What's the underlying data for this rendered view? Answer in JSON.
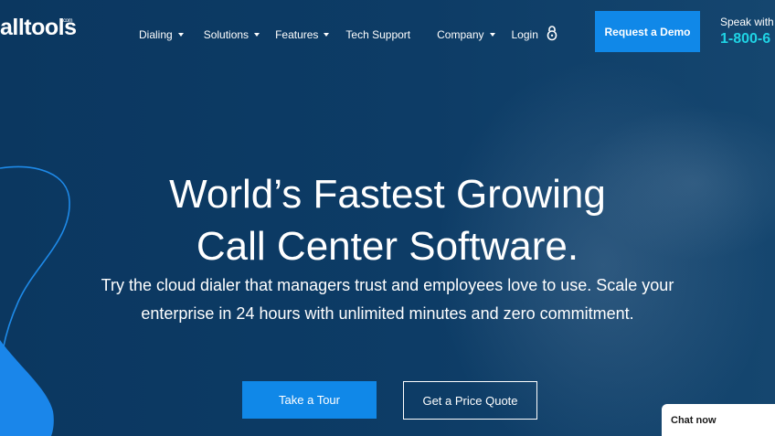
{
  "brand": {
    "logo_text": "alltools",
    "logo_sup": ".com"
  },
  "nav": {
    "items": [
      {
        "label": "Dialing",
        "dropdown": true
      },
      {
        "label": "Solutions",
        "dropdown": true
      },
      {
        "label": "Features",
        "dropdown": true
      },
      {
        "label": "Tech Support",
        "dropdown": false
      },
      {
        "label": "Company",
        "dropdown": true
      },
      {
        "label": "Login",
        "icon": "lock-icon"
      }
    ]
  },
  "header": {
    "demo_label": "Request a Demo",
    "speak_label": "Speak with a",
    "phone": "1-800-6"
  },
  "hero": {
    "headline_line1": "World’s Fastest Growing",
    "headline_line2": "Call Center Software.",
    "sub_line1": "Try the cloud dialer that managers trust and employees love to use. Scale your",
    "sub_line2": "enterprise in 24 hours with unlimited minutes and zero commitment.",
    "tour_label": "Take a Tour",
    "quote_label": "Get a Price Quote"
  },
  "chat": {
    "label": "Chat now"
  },
  "colors": {
    "background": "#0c3a63",
    "accent": "#1088e8",
    "phone": "#1fd3e4"
  }
}
